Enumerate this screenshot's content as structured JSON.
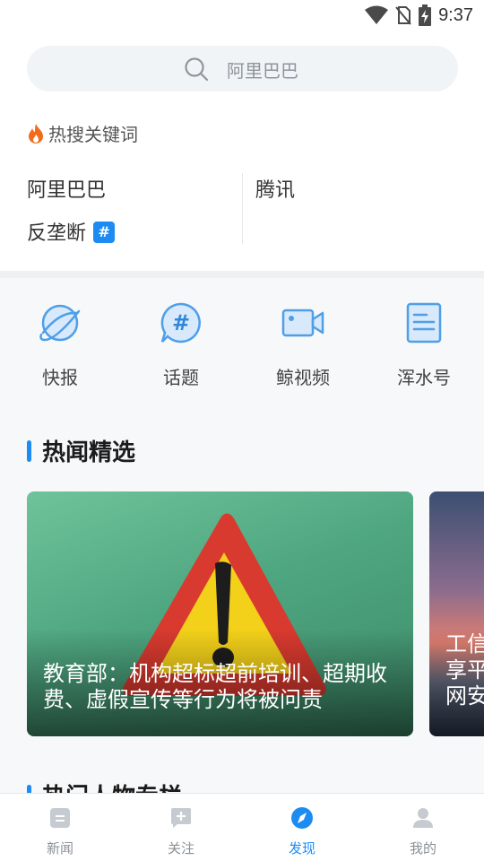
{
  "status": {
    "time": "9:37"
  },
  "search": {
    "placeholder": "阿里巴巴",
    "icon": "search-icon"
  },
  "hot_search": {
    "title": "热搜关键词",
    "keywords": [
      {
        "text": "阿里巴巴"
      },
      {
        "text": "腾讯"
      },
      {
        "text": "反垄断",
        "badge": "#"
      }
    ]
  },
  "quick_links": [
    {
      "label": "快报",
      "icon": "planet-icon"
    },
    {
      "label": "话题",
      "icon": "hashtag-bubble-icon"
    },
    {
      "label": "鲸视频",
      "icon": "video-camera-icon"
    },
    {
      "label": "浑水号",
      "icon": "document-icon"
    }
  ],
  "featured": {
    "title": "热闻精选",
    "cards": [
      {
        "title": "教育部：机构超标超前培训、超期收费、虚假宣传等行为将被问责"
      },
      {
        "title": "工信\n享平\n网安"
      }
    ]
  },
  "section2": {
    "title": "热门人物专栏"
  },
  "tabbar": {
    "items": [
      {
        "label": "新闻",
        "icon": "news-icon",
        "active": false
      },
      {
        "label": "关注",
        "icon": "follow-icon",
        "active": false
      },
      {
        "label": "发现",
        "icon": "compass-icon",
        "active": true
      },
      {
        "label": "我的",
        "icon": "profile-icon",
        "active": false
      }
    ]
  },
  "colors": {
    "accent": "#1c8cf2",
    "flame": "#f26b1d"
  }
}
